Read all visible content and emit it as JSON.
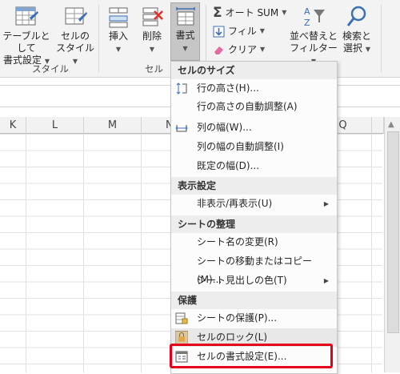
{
  "ribbon": {
    "styles": {
      "table_format": {
        "line1": "テーブルとして",
        "line2": "書式設定"
      },
      "cell_style": {
        "line1": "セルの",
        "line2": "スタイル"
      },
      "group_label": "スタイル"
    },
    "cells": {
      "insert_label": "挿入",
      "delete_label": "削除",
      "format_label": "書式",
      "group_label": "セル"
    },
    "editing": {
      "autosum_label": "オート SUM",
      "fill_label": "フィル",
      "clear_label": "クリア",
      "sort_filter": {
        "line1": "並べ替えと",
        "line2": "フィルター"
      },
      "find_select": {
        "line1": "検索と",
        "line2": "選択"
      }
    }
  },
  "grid": {
    "columns": [
      "K",
      "L",
      "M",
      "N",
      "Q"
    ]
  },
  "menu": {
    "sections": [
      {
        "title": "セルのサイズ",
        "items": [
          "行の高さ(H)...",
          "行の高さの自動調整(A)",
          "列の幅(W)...",
          "列の幅の自動調整(I)",
          "既定の幅(D)..."
        ]
      },
      {
        "title": "表示設定",
        "items": [
          "非表示/再表示(U)"
        ]
      },
      {
        "title": "シートの整理",
        "items": [
          "シート名の変更(R)",
          "シートの移動またはコピー(M)...",
          "シート見出しの色(T)"
        ]
      },
      {
        "title": "保護",
        "items": [
          "シートの保護(P)...",
          "セルのロック(L)",
          "セルの書式設定(E)..."
        ]
      }
    ]
  },
  "colors": {
    "highlight": "#e4001b",
    "accent": "#217346"
  }
}
